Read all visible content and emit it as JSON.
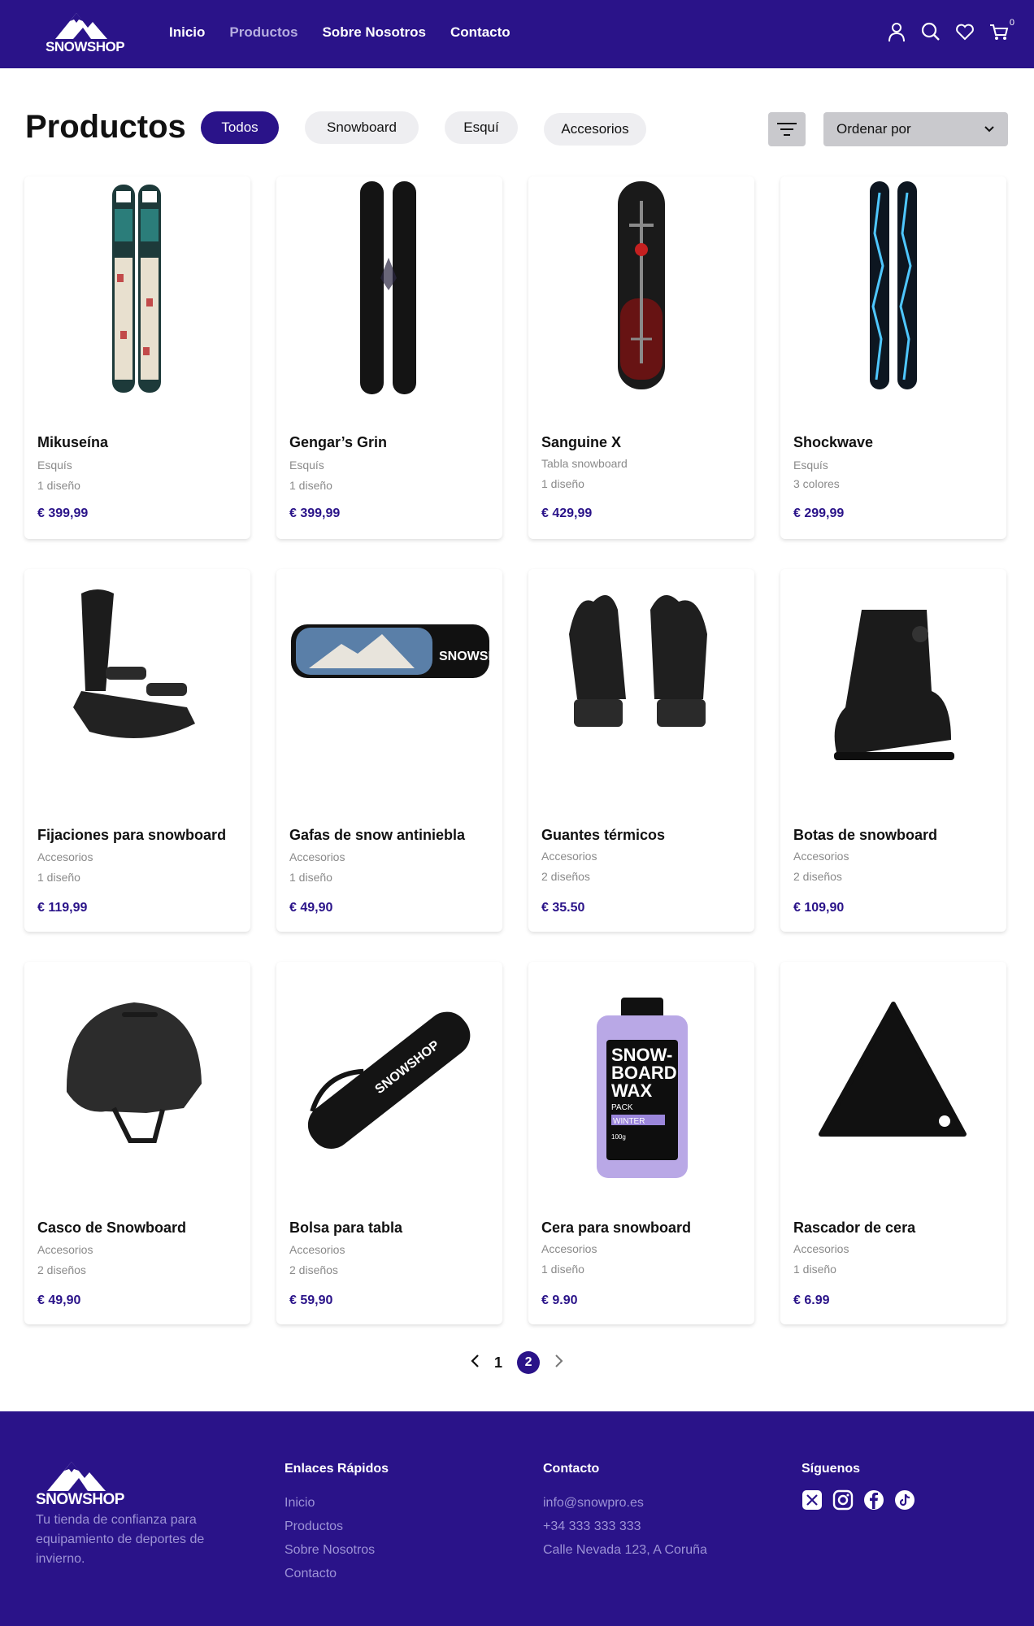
{
  "brand": {
    "name": "SNOWSHOP"
  },
  "nav": {
    "items": [
      {
        "label": "Inicio"
      },
      {
        "label": "Productos"
      },
      {
        "label": "Sobre Nosotros"
      },
      {
        "label": "Contacto"
      }
    ],
    "active": "Productos",
    "cart_count": "0"
  },
  "page": {
    "title": "Productos",
    "filters": [
      "Todos",
      "Snowboard",
      "Esquí",
      "Accesorios"
    ],
    "active_filter": "Todos",
    "sort_label": "Ordenar por"
  },
  "products": [
    {
      "name": "Mikuseína",
      "category": "Esquís",
      "variants": "1 diseño",
      "price": "€ 399,99",
      "icon": "anime-skis-image"
    },
    {
      "name": "Gengar’s Grin",
      "category": "Esquís",
      "variants": "1 diseño",
      "price": "€ 399,99",
      "icon": "black-skis-image"
    },
    {
      "name": "Sanguine X",
      "category": "Tabla snowboard",
      "variants": "1 diseño",
      "price": "€ 429,99",
      "icon": "red-snowboard-image"
    },
    {
      "name": "Shockwave",
      "category": "Esquís",
      "variants": "3 colores",
      "price": "€ 299,99",
      "icon": "lightning-skis-image"
    },
    {
      "name": "Fijaciones para snowboard",
      "category": "Accesorios",
      "variants": "1 diseño",
      "price": "€ 119,99",
      "icon": "binding-image"
    },
    {
      "name": "Gafas de snow antiniebla",
      "category": "Accesorios",
      "variants": "1 diseño",
      "price": "€ 49,90",
      "icon": "goggles-image"
    },
    {
      "name": "Guantes térmicos",
      "category": "Accesorios",
      "variants": "2 diseños",
      "price": "€ 35.50",
      "icon": "gloves-image"
    },
    {
      "name": "Botas de snowboard",
      "category": "Accesorios",
      "variants": "2 diseños",
      "price": "€ 109,90",
      "icon": "boot-image"
    },
    {
      "name": "Casco de Snowboard",
      "category": "Accesorios",
      "variants": "2 diseños",
      "price": "€ 49,90",
      "icon": "helmet-image"
    },
    {
      "name": "Bolsa para tabla",
      "category": "Accesorios",
      "variants": "2 diseños",
      "price": "€ 59,90",
      "icon": "board-bag-image"
    },
    {
      "name": "Cera para snowboard",
      "category": "Accesorios",
      "variants": "1 diseño",
      "price": "€ 9.90",
      "icon": "wax-bottle-image"
    },
    {
      "name": "Rascador de cera",
      "category": "Accesorios",
      "variants": "1 diseño",
      "price": "€ 6.99",
      "icon": "wax-scraper-image"
    }
  ],
  "product_image_text": {
    "goggles_strap": "SNOWSHOP",
    "bag_print": "SNOWSHOP",
    "wax_label": [
      "SNOW-",
      "BOARD",
      "WAX",
      "PACK",
      "WINTER",
      "100g"
    ]
  },
  "pagination": {
    "pages": [
      "1",
      "2"
    ],
    "current": "2"
  },
  "footer": {
    "tagline": "Tu tienda de confianza para equipamiento de deportes de invierno.",
    "quick_links_title": "Enlaces Rápidos",
    "quick_links": [
      "Inicio",
      "Productos",
      "Sobre Nosotros",
      "Contacto"
    ],
    "contact_title": "Contacto",
    "contact": [
      "info@snowpro.es",
      "+34 333 333 333",
      "Calle Nevada 123, A Coruña"
    ],
    "social_title": "Síguenos",
    "socials": [
      "x-icon",
      "instagram-icon",
      "facebook-icon",
      "tiktok-icon"
    ]
  },
  "colors": {
    "primary": "#2a1389",
    "muted": "#8a8a8a",
    "chip": "#eeeef1"
  }
}
